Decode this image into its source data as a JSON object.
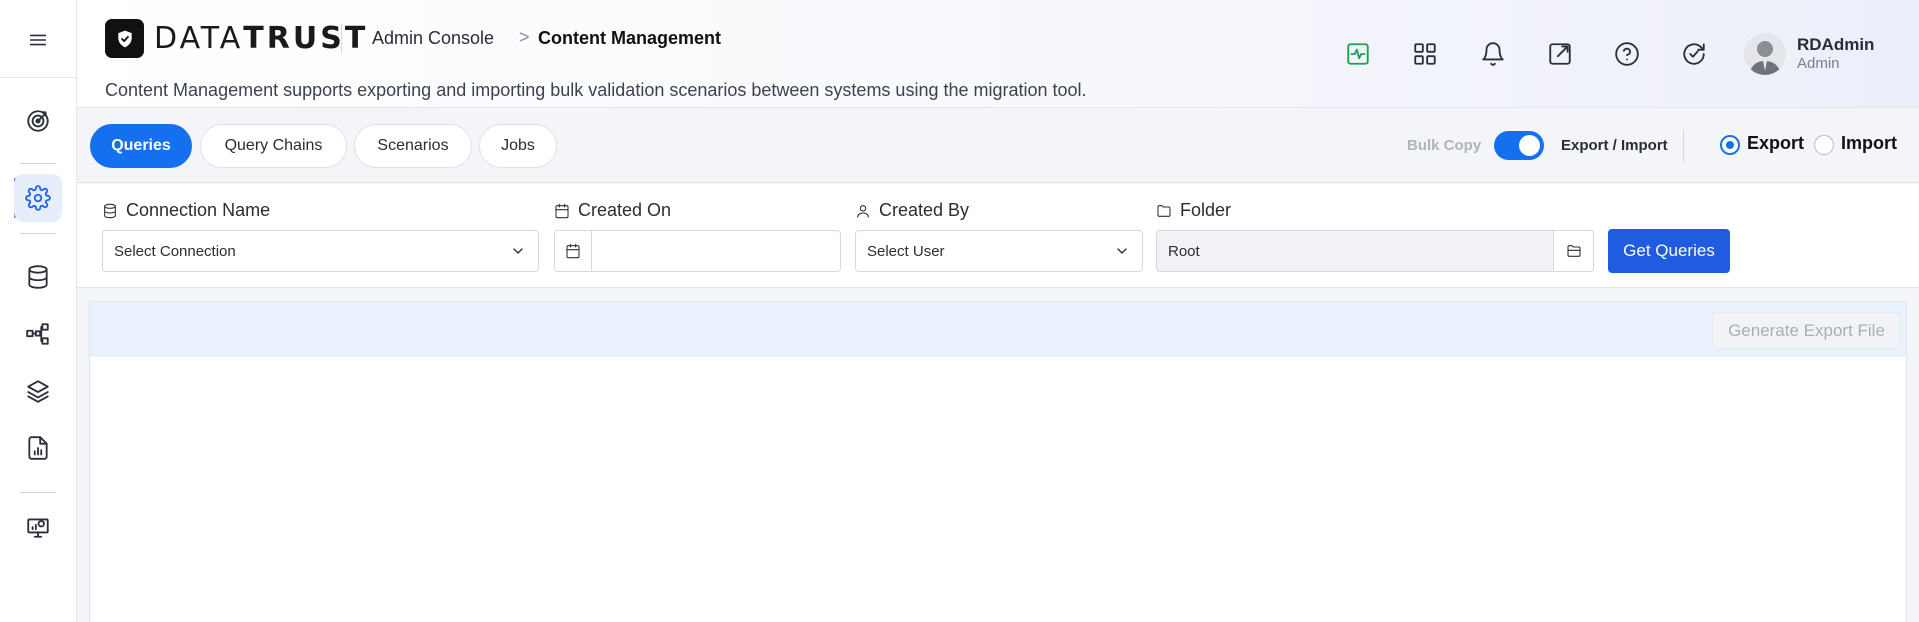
{
  "app": {
    "brand_light": "DATA",
    "brand_bold": "TRUST"
  },
  "breadcrumb": {
    "parent": "Admin Console",
    "separator": ">",
    "current": "Content Management"
  },
  "page": {
    "description": "Content Management supports exporting and importing bulk validation scenarios between systems using the migration tool."
  },
  "sidebar": {
    "items": [
      {
        "icon": "menu-icon"
      },
      {
        "icon": "target-icon"
      },
      {
        "icon": "gear-icon",
        "active": true
      },
      {
        "icon": "database-icon"
      },
      {
        "icon": "workflow-icon"
      },
      {
        "icon": "layers-icon"
      },
      {
        "icon": "report-icon"
      },
      {
        "icon": "monitor-icon"
      }
    ]
  },
  "header_icons": [
    "activity-icon",
    "apps-grid-icon",
    "bell-icon",
    "external-link-icon",
    "help-icon",
    "refresh-check-icon"
  ],
  "user": {
    "name": "RDAdmin",
    "role": "Admin"
  },
  "tabs": [
    {
      "label": "Queries",
      "active": true
    },
    {
      "label": "Query Chains"
    },
    {
      "label": "Scenarios"
    },
    {
      "label": "Jobs"
    }
  ],
  "mode": {
    "bulk_copy_label": "Bulk Copy",
    "toggle_on": true,
    "toggle_label": "Export / Import",
    "export_label": "Export",
    "import_label": "Import",
    "selected": "Export"
  },
  "filters": {
    "connection": {
      "label": "Connection Name",
      "value": "Select Connection"
    },
    "created_on": {
      "label": "Created On",
      "value": ""
    },
    "created_by": {
      "label": "Created By",
      "value": "Select User"
    },
    "folder": {
      "label": "Folder",
      "value": "Root"
    },
    "submit_label": "Get Queries"
  },
  "panel": {
    "generate_label": "Generate Export File"
  },
  "colors": {
    "accent": "#1570ef",
    "primary_button": "#1f5ce0",
    "status_green": "#16a34a"
  }
}
